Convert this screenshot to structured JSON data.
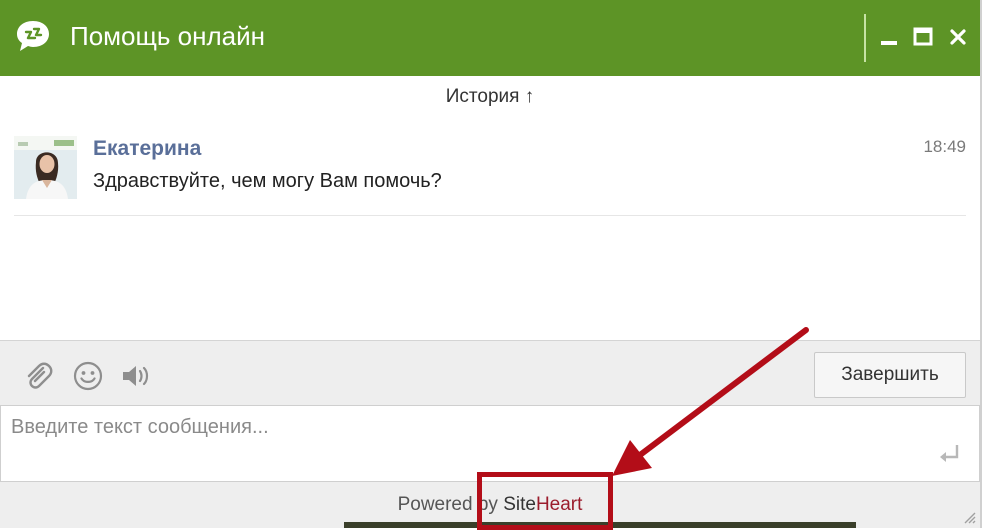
{
  "window": {
    "title": "Помощь онлайн",
    "accent_color": "#5d9426",
    "logo_icon": "chat-bubble-logo-icon",
    "controls": [
      "minimize-icon",
      "maximize-icon",
      "close-icon"
    ]
  },
  "history": {
    "label": "История ↑"
  },
  "messages": [
    {
      "author": "Екатерина",
      "time": "18:49",
      "text": "Здравствуйте, чем могу Вам помочь?"
    }
  ],
  "toolbar": {
    "icons": [
      "paperclip-icon",
      "smiley-icon",
      "sound-icon"
    ],
    "end_button_label": "Завершить"
  },
  "composer": {
    "placeholder": "Введите текст сообщения...",
    "value": "",
    "send_icon": "enter-icon"
  },
  "footer": {
    "powered_prefix": "Powered by ",
    "brand_site": "Site",
    "brand_heart": "Heart",
    "brand_color": "#9b1c2c"
  },
  "annotation": {
    "color": "#b30d18"
  }
}
